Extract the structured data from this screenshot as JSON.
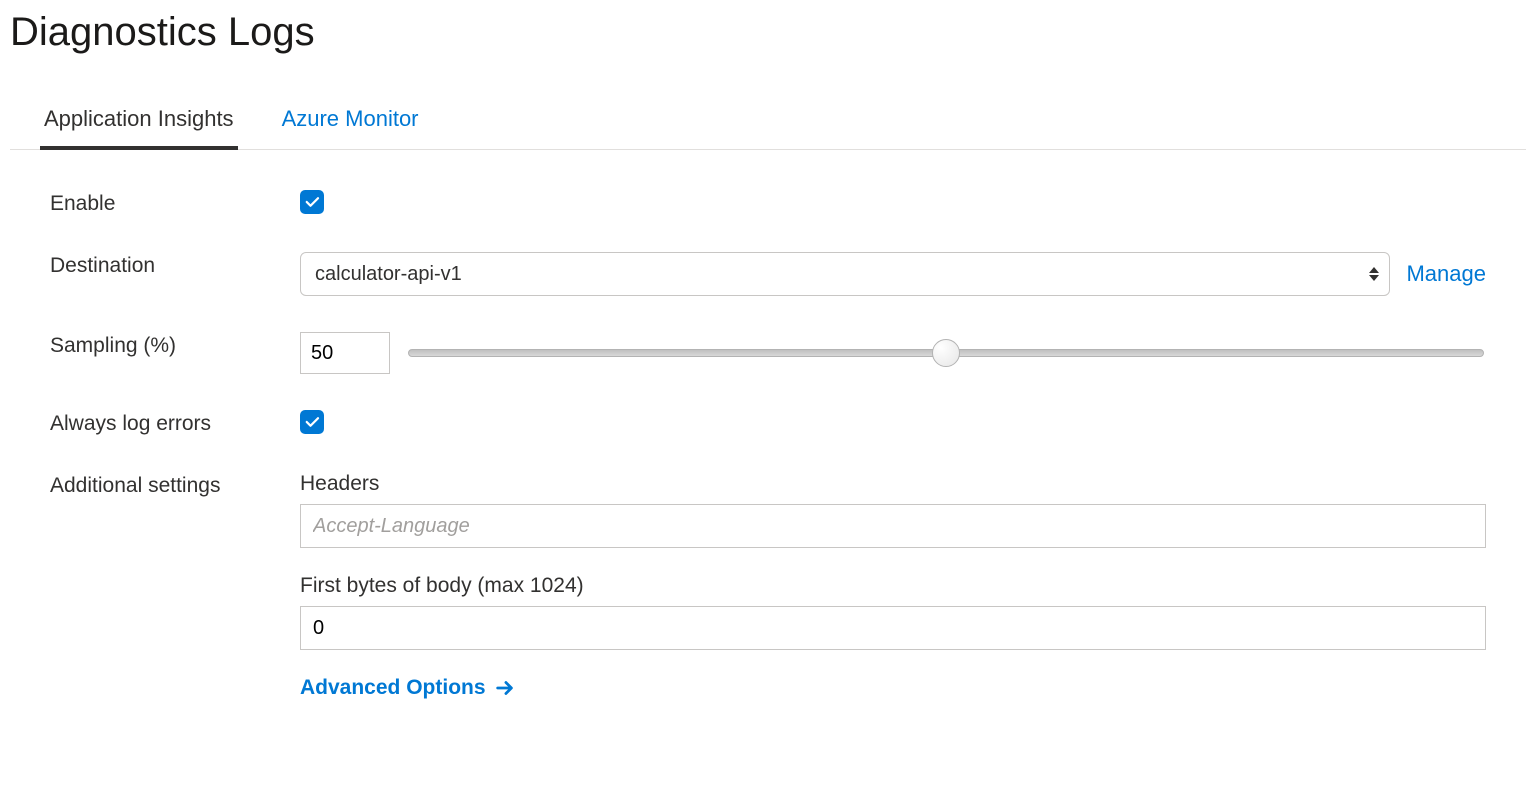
{
  "title": "Diagnostics Logs",
  "tabs": [
    {
      "label": "Application Insights",
      "active": true
    },
    {
      "label": "Azure Monitor",
      "active": false
    }
  ],
  "form": {
    "enable": {
      "label": "Enable",
      "checked": true
    },
    "destination": {
      "label": "Destination",
      "selected": "calculator-api-v1",
      "manage_label": "Manage"
    },
    "sampling": {
      "label": "Sampling (%)",
      "value": "50",
      "min": 0,
      "max": 100
    },
    "always_log_errors": {
      "label": "Always log errors",
      "checked": true
    },
    "additional": {
      "label": "Additional settings",
      "headers_label": "Headers",
      "headers_placeholder": "Accept-Language",
      "headers_value": "",
      "body_label": "First bytes of body (max 1024)",
      "body_value": "0",
      "advanced_label": "Advanced Options"
    }
  }
}
